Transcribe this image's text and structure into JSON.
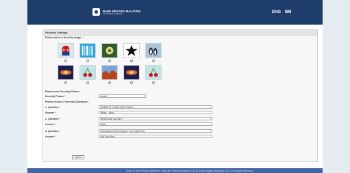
{
  "header": {
    "logo_name": "BANK NEGARA MALAYSIA",
    "logo_subtitle": "Central Bank of Malaysia",
    "lang_eng": "ENG",
    "lang_bm": "BM"
  },
  "panel": {
    "title": "Security Settings",
    "select_image_label": "Please select a Security Image :",
    "required_mark": "*",
    "images": [
      {
        "name": "spiderman-icon"
      },
      {
        "name": "barcode-icon"
      },
      {
        "name": "flower-icon"
      },
      {
        "name": "star-icon"
      },
      {
        "name": "penguins-icon"
      },
      {
        "name": "galaxy-icon"
      },
      {
        "name": "cherries-icon"
      },
      {
        "name": "canyon-icon"
      },
      {
        "name": "galaxy-icon"
      },
      {
        "name": "cherries-icon"
      }
    ],
    "selected_image": 3,
    "phrase_section_label": "Please enter Security Phrase :",
    "phrase_label": "Security Phrase",
    "phrase_value": "abcdef",
    "questions_section_label": "Please choose 3 Security Questions :",
    "questions": [
      {
        "label": "1. Question",
        "value": "WHERE IS YOUR HOME TOWN?",
        "answer_label": "Answer",
        "answer": "Studio , Johor"
      },
      {
        "label": "2. Question",
        "value": "What is your car color?",
        "answer_label": "Answer",
        "answer": "White"
      },
      {
        "label": "3. Question",
        "value": "What was the first company I ever worked for?",
        "answer_label": "Answer",
        "answer": "ABC Sdn. Bhd."
      }
    ],
    "submit_label": "Submit"
  },
  "corner_text": "· · · · · ·",
  "footer": {
    "text": "Terms of Use   Privacy Statement   Security Policy   Disclaimer   © 2015 Bank Negara Malaysia 2015. All Rights Reserved"
  }
}
